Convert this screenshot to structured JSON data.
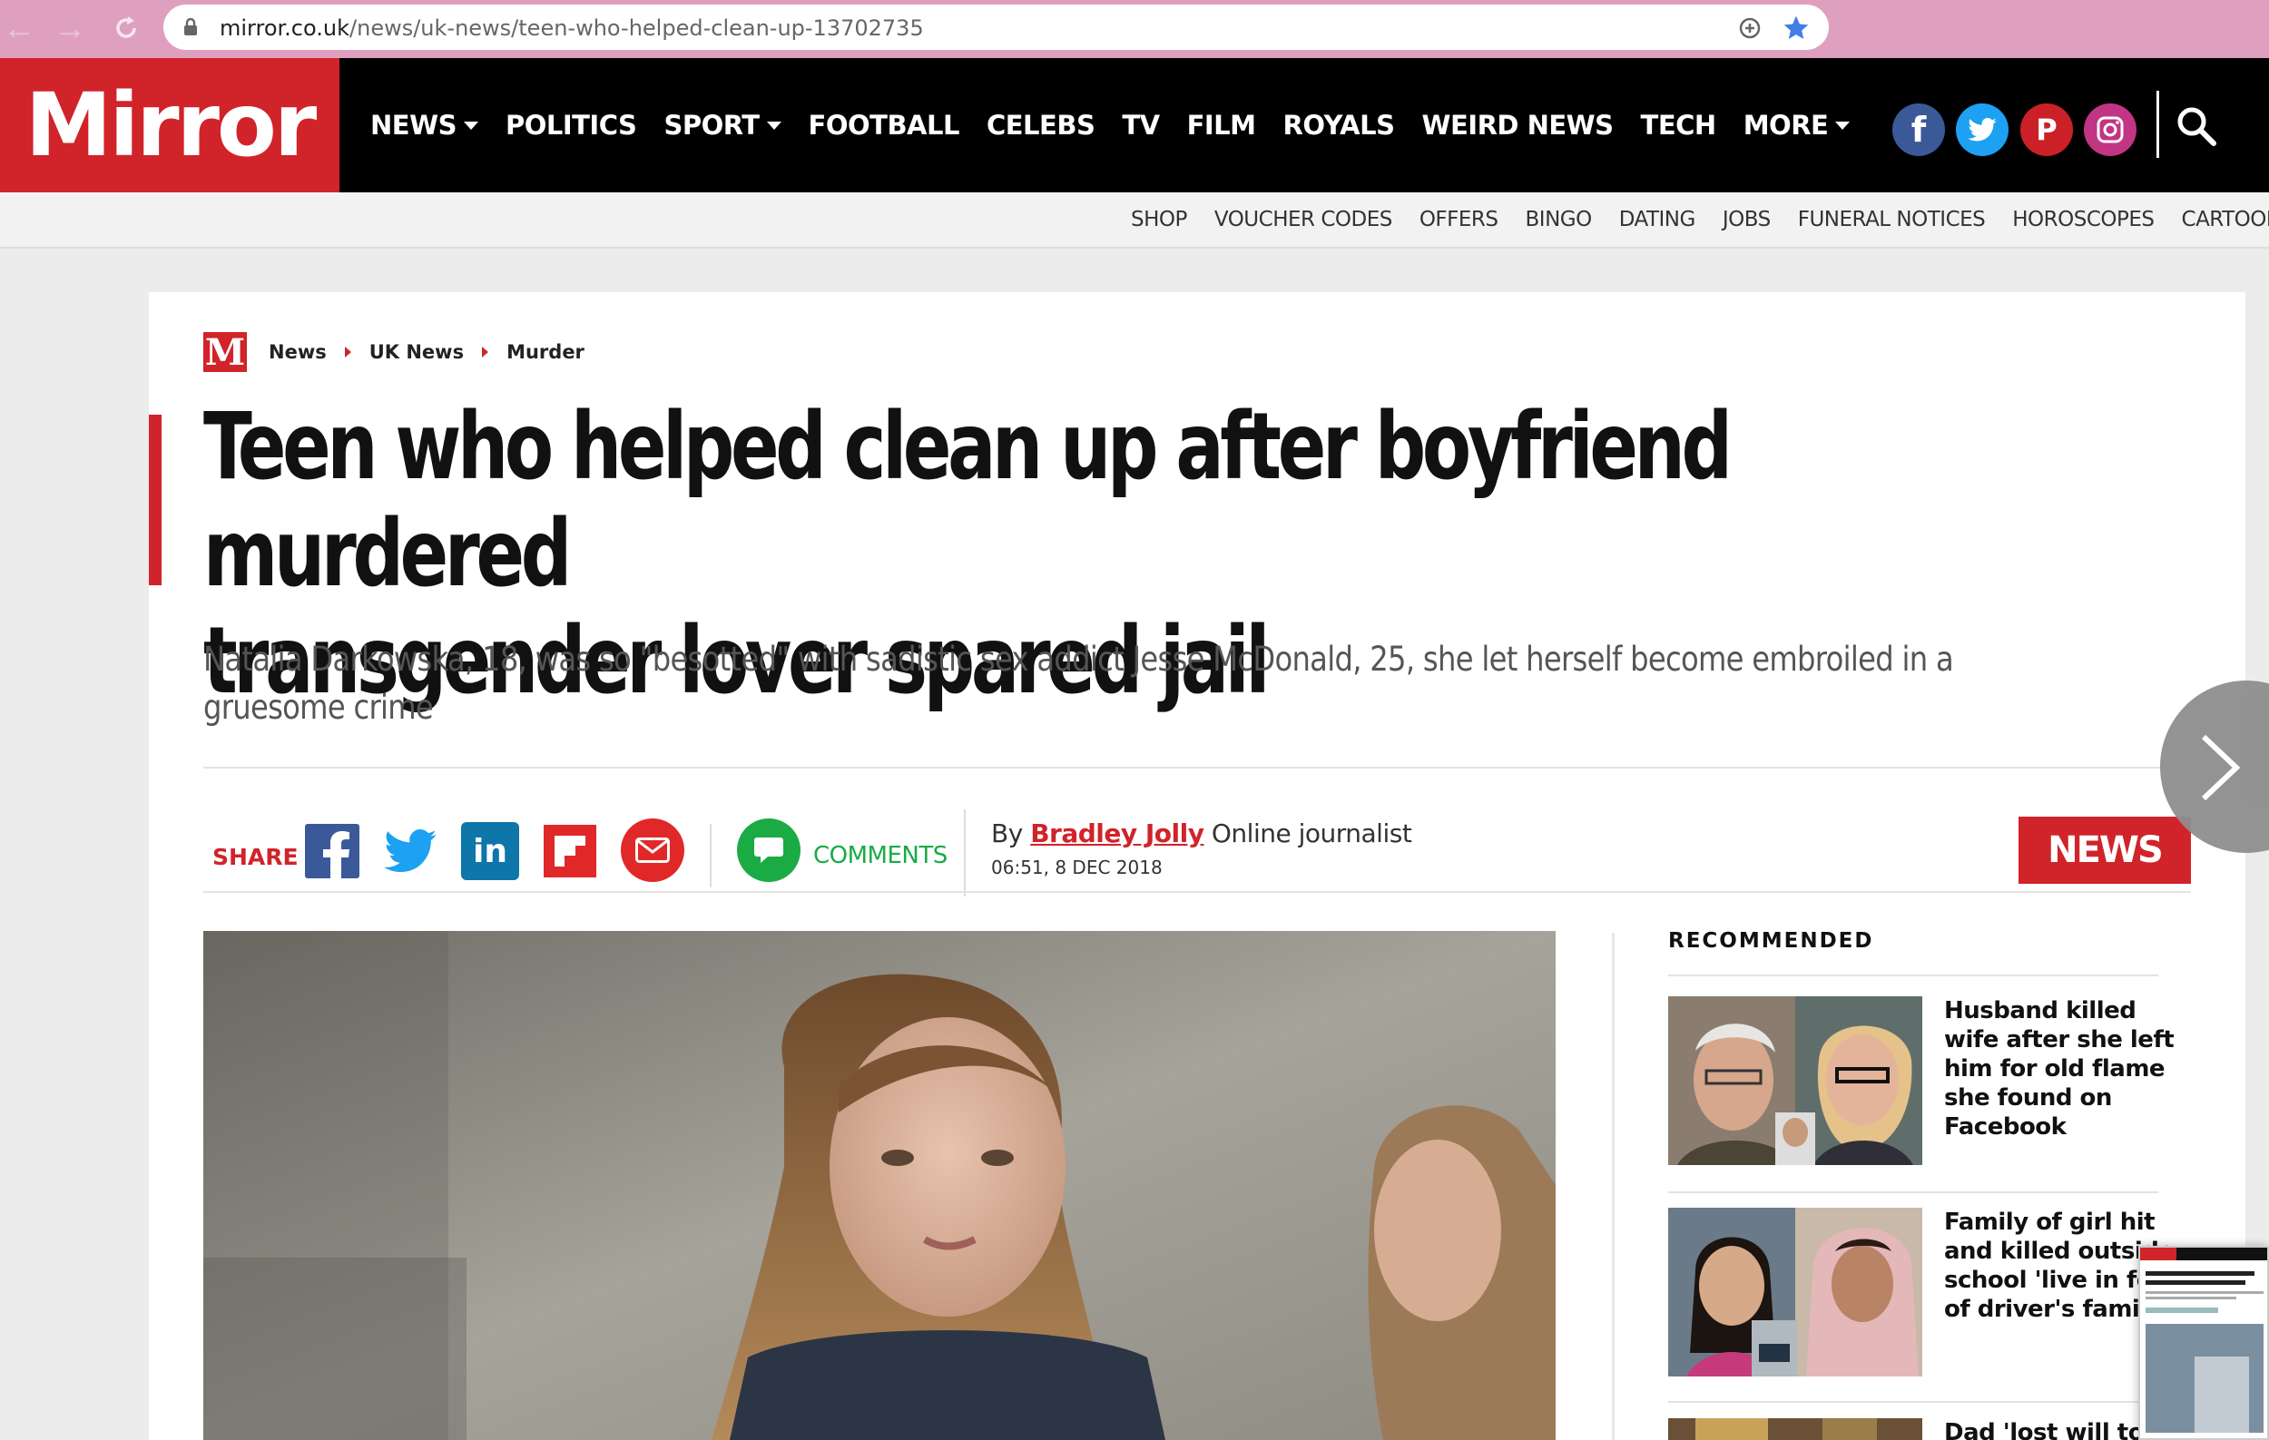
{
  "browser": {
    "url_host": "mirror.co.uk",
    "url_path": "/news/uk-news/teen-who-helped-clean-up-13702735"
  },
  "header": {
    "logo": "Mirror",
    "nav": [
      {
        "label": "NEWS",
        "dropdown": true
      },
      {
        "label": "POLITICS",
        "dropdown": false
      },
      {
        "label": "SPORT",
        "dropdown": true
      },
      {
        "label": "FOOTBALL",
        "dropdown": false
      },
      {
        "label": "CELEBS",
        "dropdown": false
      },
      {
        "label": "TV",
        "dropdown": false
      },
      {
        "label": "FILM",
        "dropdown": false
      },
      {
        "label": "ROYALS",
        "dropdown": false
      },
      {
        "label": "WEIRD NEWS",
        "dropdown": false
      },
      {
        "label": "TECH",
        "dropdown": false
      },
      {
        "label": "MORE",
        "dropdown": true
      }
    ],
    "social": [
      {
        "name": "facebook-icon",
        "glyph": "f",
        "color": "#3b5998"
      },
      {
        "name": "twitter-icon",
        "glyph": "",
        "color": "#1da1f2"
      },
      {
        "name": "pinterest-icon",
        "glyph": "P",
        "color": "#cb2027"
      },
      {
        "name": "instagram-icon",
        "glyph": "",
        "color": "#c13584"
      }
    ],
    "subnav": [
      "SHOP",
      "VOUCHER CODES",
      "OFFERS",
      "BINGO",
      "DATING",
      "JOBS",
      "FUNERAL NOTICES",
      "HOROSCOPES",
      "CARTOONS",
      "C"
    ]
  },
  "article": {
    "breadcrumb": [
      "News",
      "UK News",
      "Murder"
    ],
    "headline_line1": "Teen who helped clean up after boyfriend murdered",
    "headline_line2": "transgender lover spared jail",
    "standfirst": "Natalia Darkowska, 18, was so \"besotted\" with sadistic sex addict Jesse McDonald, 25, she let herself become embroiled in a gruesome crime",
    "share_label": "SHARE",
    "comments_label": "COMMENTS",
    "byline_prefix": "By",
    "author": "Bradley Jolly",
    "author_role": "Online journalist",
    "timestamp": "06:51, 8 DEC 2018",
    "section_tag": "NEWS"
  },
  "recommended": {
    "title": "RECOMMENDED",
    "items": [
      {
        "headline": "Husband killed wife after she left him for old flame she found on Facebook"
      },
      {
        "headline": "Family of girl hit and killed outside school 'live in fear of driver's family"
      },
      {
        "headline": "Dad 'lost will to live'"
      }
    ]
  },
  "colors": {
    "brand_red": "#d1232a",
    "chrome_pink": "#dfa0c0",
    "comments_green": "#1aab45"
  }
}
